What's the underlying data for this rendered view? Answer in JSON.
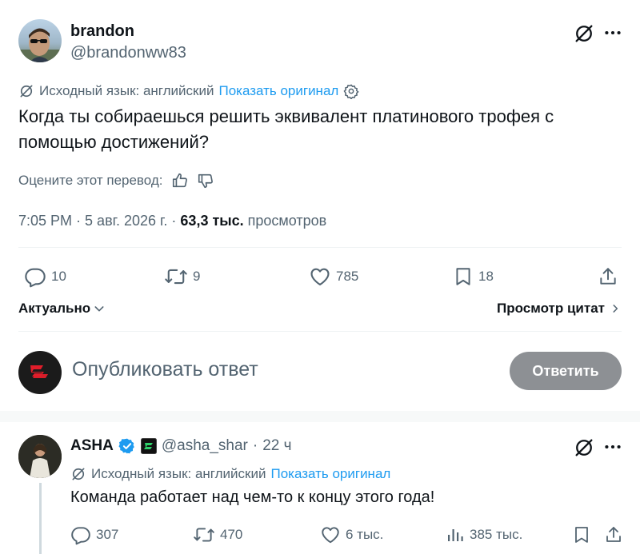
{
  "tweet": {
    "display_name": "brandon",
    "handle": "@brandonww83",
    "translation": {
      "source": "Исходный язык: английский",
      "show_original": "Показать оригинал"
    },
    "text": "Когда ты собираешься решить эквивалент платинового трофея с помощью достижений?",
    "rate_label": "Оцените этот перевод:",
    "time": "7:05 PM",
    "date": "5 авг. 2026 г.",
    "views_count": "63,3 тыс.",
    "views_label": "просмотров",
    "separator": "·",
    "actions": {
      "replies": "10",
      "reposts": "9",
      "likes": "785",
      "bookmarks": "18"
    }
  },
  "sort_label": "Актуально",
  "quotes_label": "Просмотр цитат",
  "compose": {
    "placeholder": "Опубликовать ответ",
    "button": "Ответить"
  },
  "reply_tweet": {
    "display_name": "ASHA",
    "handle": "@asha_shar",
    "time": "22 ч",
    "translation": {
      "source": "Исходный язык: английский",
      "show_original": "Показать оригинал"
    },
    "text": "Команда работает над чем-то к концу этого года!",
    "actions": {
      "replies": "307",
      "reposts": "470",
      "likes": "6 тыс.",
      "views": "385 тыс."
    }
  },
  "colors": {
    "accent": "#1d9bf0",
    "muted": "#536471",
    "verified": "#1d9bf0",
    "button_disabled": "#8d9094"
  },
  "icons": [
    "translate-icon",
    "more-icon",
    "settings-icon",
    "thumbs-up-icon",
    "thumbs-down-icon",
    "reply-icon",
    "repost-icon",
    "like-icon",
    "bookmark-icon",
    "share-icon",
    "chevron-down-icon",
    "chevron-right-icon",
    "verified-icon",
    "views-icon"
  ]
}
